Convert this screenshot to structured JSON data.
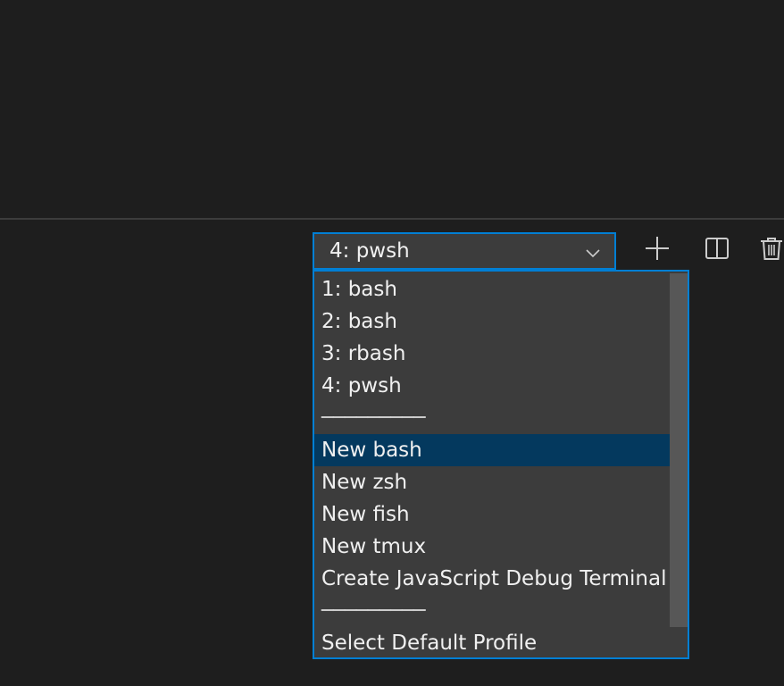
{
  "terminal_select": {
    "selected": "4: pwsh"
  },
  "toolbar": {
    "new_terminal_icon": "plus-icon",
    "split_terminal_icon": "split-icon",
    "kill_terminal_icon": "trash-icon"
  },
  "dropdown": {
    "options": [
      {
        "label": "1: bash"
      },
      {
        "label": "2: bash"
      },
      {
        "label": "3: rbash"
      },
      {
        "label": "4: pwsh"
      },
      {
        "label": "─────────"
      },
      {
        "label": "New bash"
      },
      {
        "label": "New zsh"
      },
      {
        "label": "New fish"
      },
      {
        "label": "New tmux"
      },
      {
        "label": "Create JavaScript Debug Terminal"
      },
      {
        "label": "─────────"
      },
      {
        "label": "Select Default Profile"
      }
    ],
    "highlighted": "New bash"
  },
  "colors": {
    "background": "#1e1e1e",
    "dropdown_bg": "#3c3c3c",
    "focus_border": "#007fd4",
    "selection": "#04395e"
  }
}
